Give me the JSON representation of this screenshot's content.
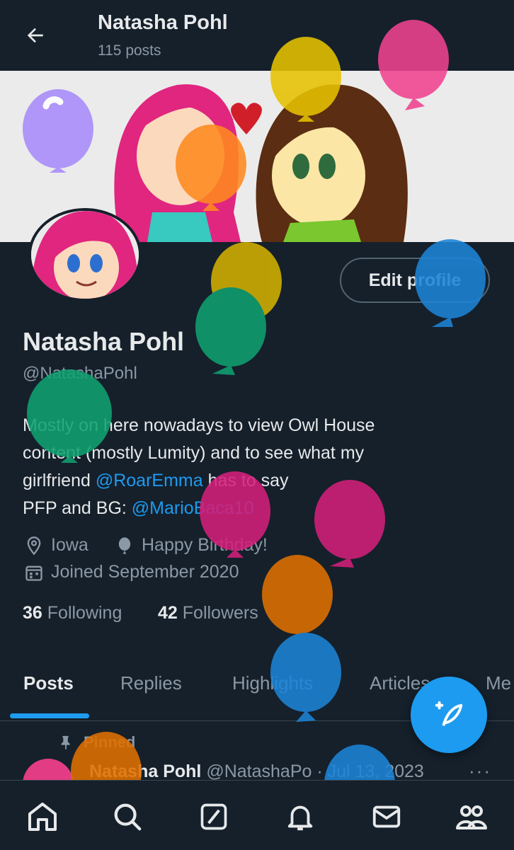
{
  "header": {
    "name": "Natasha Pohl",
    "posts": "115 posts"
  },
  "profile": {
    "name": "Natasha Pohl",
    "handle": "@NatashaPohl",
    "edit_label": "Edit profile",
    "bio_line1": "Mostly on here nowadays to view Owl House",
    "bio_line2": "content (mostly Lumity) and to see what my",
    "bio_line3_pre": "girlfriend ",
    "bio_line3_link": "@RoarEmma",
    "bio_line3_post": " has to say",
    "bio_line4_pre": "PFP and BG: ",
    "bio_line4_link": "@MarioBaca10",
    "location": "Iowa",
    "birthday": "Happy Birthday!",
    "joined": "Joined September 2020",
    "following_count": "36",
    "following_label": "Following",
    "followers_count": "42",
    "followers_label": "Followers"
  },
  "tabs": [
    "Posts",
    "Replies",
    "Highlights",
    "Articles",
    "Me"
  ],
  "pinned": {
    "label": "Pinned",
    "name": "Natasha Pohl",
    "handle_date": "@NatashaPo · Jul 13, 2023",
    "more": "···"
  },
  "nav": [
    "home-icon",
    "search-icon",
    "grok-icon",
    "bell-icon",
    "mail-icon",
    "communities-icon"
  ],
  "colors": {
    "background": "#15202b",
    "accent": "#1d9bf0",
    "muted": "#8b98a5"
  }
}
